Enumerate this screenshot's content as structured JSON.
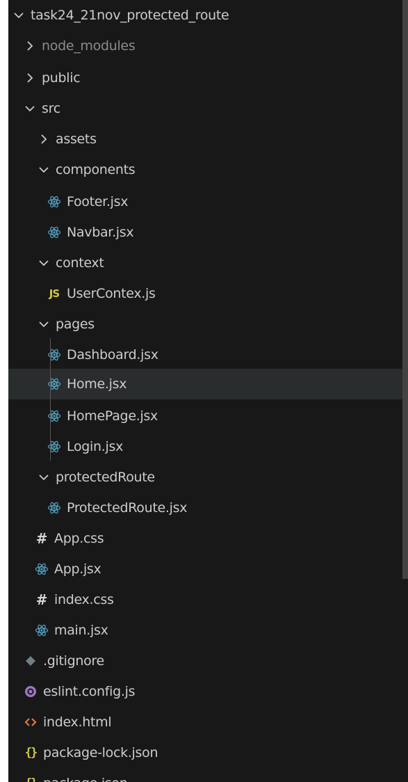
{
  "explorer": {
    "root": "task24_21nov_protected_route",
    "items": [
      {
        "name": "node_modules",
        "kind": "folder",
        "open": false,
        "muted": true,
        "icon": "chevron-right-icon"
      },
      {
        "name": "public",
        "kind": "folder",
        "open": false,
        "icon": "chevron-right-icon"
      },
      {
        "name": "src",
        "kind": "folder",
        "open": true,
        "icon": "chevron-down-icon"
      },
      {
        "name": "assets",
        "kind": "folder",
        "open": false,
        "icon": "chevron-right-icon"
      },
      {
        "name": "components",
        "kind": "folder",
        "open": true,
        "icon": "chevron-down-icon"
      },
      {
        "name": "Footer.jsx",
        "kind": "file",
        "icon": "react-icon"
      },
      {
        "name": "Navbar.jsx",
        "kind": "file",
        "icon": "react-icon"
      },
      {
        "name": "context",
        "kind": "folder",
        "open": true,
        "icon": "chevron-down-icon"
      },
      {
        "name": "UserContex.js",
        "kind": "file",
        "icon": "javascript-icon",
        "icon_text": "JS"
      },
      {
        "name": "pages",
        "kind": "folder",
        "open": true,
        "icon": "chevron-down-icon"
      },
      {
        "name": "Dashboard.jsx",
        "kind": "file",
        "icon": "react-icon"
      },
      {
        "name": "Home.jsx",
        "kind": "file",
        "icon": "react-icon",
        "selected": true
      },
      {
        "name": "HomePage.jsx",
        "kind": "file",
        "icon": "react-icon"
      },
      {
        "name": "Login.jsx",
        "kind": "file",
        "icon": "react-icon"
      },
      {
        "name": "protectedRoute",
        "kind": "folder",
        "open": true,
        "icon": "chevron-down-icon"
      },
      {
        "name": "ProtectedRoute.jsx",
        "kind": "file",
        "icon": "react-icon"
      },
      {
        "name": "App.css",
        "kind": "file",
        "icon": "css-hash-icon",
        "icon_text": "#"
      },
      {
        "name": "App.jsx",
        "kind": "file",
        "icon": "react-icon"
      },
      {
        "name": "index.css",
        "kind": "file",
        "icon": "css-hash-icon",
        "icon_text": "#"
      },
      {
        "name": "main.jsx",
        "kind": "file",
        "icon": "react-icon"
      },
      {
        "name": ".gitignore",
        "kind": "file",
        "icon": "git-icon"
      },
      {
        "name": "eslint.config.js",
        "kind": "file",
        "icon": "eslint-icon"
      },
      {
        "name": "index.html",
        "kind": "file",
        "icon": "html-icon"
      },
      {
        "name": "package-lock.json",
        "kind": "file",
        "icon": "json-icon",
        "icon_text": "{}"
      },
      {
        "name": "package.json",
        "kind": "file",
        "icon": "json-icon",
        "icon_text": "{}"
      }
    ]
  },
  "colors": {
    "background": "#181818",
    "text": "#cccccc",
    "muted_text": "#8c8c8c",
    "selected_row": "#2a2d2e",
    "react_icon": "#519aba",
    "js_icon": "#cbcb41",
    "json_icon": "#cbcb41",
    "css_icon": "#d4d7d6",
    "html_icon": "#e37933",
    "eslint_icon": "#a074c4",
    "git_icon": "#6d8086"
  }
}
